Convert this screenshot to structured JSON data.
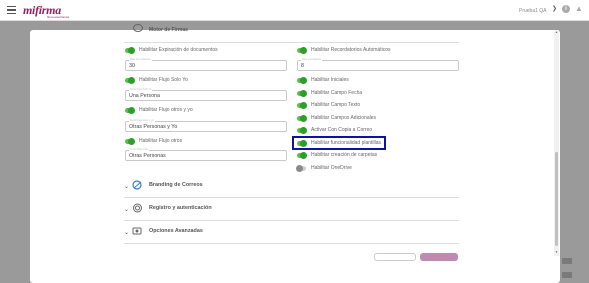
{
  "topbar": {
    "brand": "mifirma",
    "brand_sub": "firma electrónica",
    "user_name": "Prueba1 QA",
    "info_glyph": "i",
    "icons": [
      "menu-icon",
      "chevron-down-icon",
      "info-icon",
      "bell-icon"
    ]
  },
  "section_top": {
    "title": "Motor de Firmas"
  },
  "left": {
    "items": [
      {
        "label": "Habilitar Expiración de documentos",
        "on": true
      },
      {
        "field_label": "Días de expiración",
        "value": "30"
      },
      {
        "label": "Habilitar Flujo Solo Yo",
        "on": true
      },
      {
        "field_label": "Texto Flujo Solo Yo",
        "value": "Una Persona"
      },
      {
        "label": "Habilitar Flujo otros y yo",
        "on": true
      },
      {
        "field_label": "Texto Flujo otros y yo",
        "value": "Otras Personas y Yo"
      },
      {
        "label": "Habilitar Flujo otros",
        "on": true
      },
      {
        "field_label": "Texto Flujo otros",
        "value": "Otras Personas"
      }
    ]
  },
  "right": {
    "items": [
      {
        "label": "Habilitar Recordatorios Automáticos",
        "on": true
      },
      {
        "field_label": "Días recordatorio",
        "value": "8"
      },
      {
        "label": "Habilitar Iniciales",
        "on": true
      },
      {
        "label": "Habilitar Campo Fecha",
        "on": true
      },
      {
        "label": "Habilitar Campo Texto",
        "on": true
      },
      {
        "label": "Habilitar Campos Adicionales",
        "on": true
      },
      {
        "label": "Activar Con Copia a Correo",
        "on": true
      },
      {
        "label": "Habilitar funcionalidad plantillas",
        "on": true
      },
      {
        "label": "Habilitar creación de carpetas",
        "on": true
      },
      {
        "label": "Habilitar OneDrive",
        "on": false
      }
    ]
  },
  "accordions": [
    {
      "title": "Branding de Correos",
      "icon": "branding-icon"
    },
    {
      "title": "Registro y autenticación",
      "icon": "fingerprint-icon"
    },
    {
      "title": "Opciones Avanzadas",
      "icon": "advanced-icon"
    }
  ],
  "colors": {
    "brand": "#9c1b5e",
    "toggle_on": "#2e9e2a",
    "highlight": "#1010a8"
  }
}
